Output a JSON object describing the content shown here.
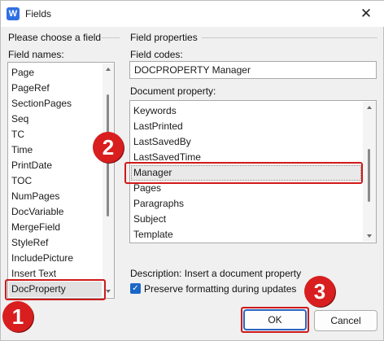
{
  "window": {
    "title": "Fields",
    "app_icon_glyph": "W",
    "close_glyph": "✕"
  },
  "left_panel": {
    "group_title": "Please choose a field",
    "list_label": "Field names:",
    "items": [
      "Page",
      "PageRef",
      "SectionPages",
      "Seq",
      "TC",
      "Time",
      "PrintDate",
      "TOC",
      "NumPages",
      "DocVariable",
      "MergeField",
      "StyleRef",
      "IncludePicture",
      "Insert Text",
      "DocProperty"
    ],
    "selected": "DocProperty"
  },
  "right_panel": {
    "group_title": "Field properties",
    "codes_label": "Field codes:",
    "codes_value": "DOCPROPERTY Manager",
    "doc_prop_label": "Document property:",
    "properties": [
      "Keywords",
      "LastPrinted",
      "LastSavedBy",
      "LastSavedTime",
      "Manager",
      "Pages",
      "Paragraphs",
      "Subject",
      "Template"
    ],
    "selected": "Manager"
  },
  "description": "Description: Insert a document property",
  "preserve_formatting": {
    "label": "Preserve formatting during updates",
    "checked": true,
    "check_glyph": "✓"
  },
  "buttons": {
    "ok": "OK",
    "cancel": "Cancel"
  },
  "annotations": {
    "step1": "1",
    "step2": "2",
    "step3": "3"
  },
  "colors": {
    "annotation_red": "#d81e1e",
    "accent_blue": "#2a66c5"
  }
}
